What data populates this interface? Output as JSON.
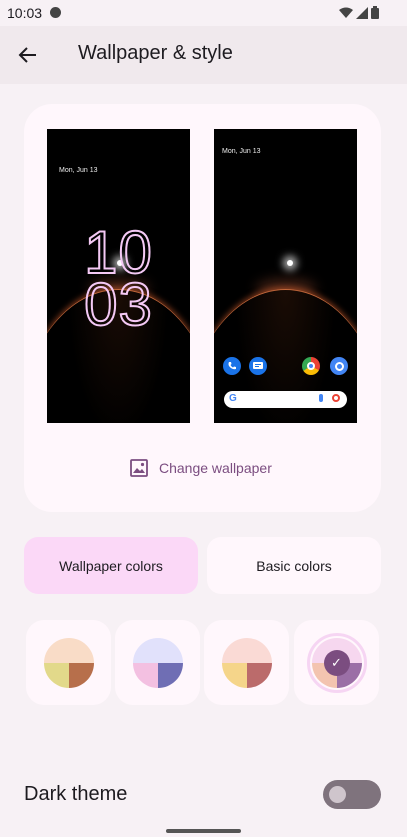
{
  "status_bar": {
    "time": "10:03"
  },
  "header": {
    "title": "Wallpaper & style"
  },
  "preview": {
    "lock_screen": {
      "date": "Mon, Jun 13",
      "clock_hours": "10",
      "clock_minutes": "03"
    },
    "home_screen": {
      "date": "Mon, Jun 13",
      "search_logo": "G"
    },
    "change_wallpaper_label": "Change wallpaper"
  },
  "tabs": [
    {
      "label": "Wallpaper colors",
      "selected": true
    },
    {
      "label": "Basic colors",
      "selected": false
    }
  ],
  "color_options": [
    {
      "top": "#f9dcc7",
      "bottom_left": "#e2d98a",
      "bottom_right": "#b76f4b",
      "selected": false
    },
    {
      "top": "#e1e1fb",
      "bottom_left": "#f3c0e1",
      "bottom_right": "#6f6eb4",
      "selected": false
    },
    {
      "top": "#fadad5",
      "bottom_left": "#f5d58a",
      "bottom_right": "#bb6b6b",
      "selected": false
    },
    {
      "top": "#f6d7ef",
      "bottom_left": "#f3c4b0",
      "bottom_right": "#9b6fa6",
      "selected": true
    }
  ],
  "dark_theme": {
    "label": "Dark theme",
    "enabled": false
  },
  "colors": {
    "accent": "#7b4d80",
    "selected_tab": "#fbd8f7",
    "background": "#f7f1f5"
  }
}
